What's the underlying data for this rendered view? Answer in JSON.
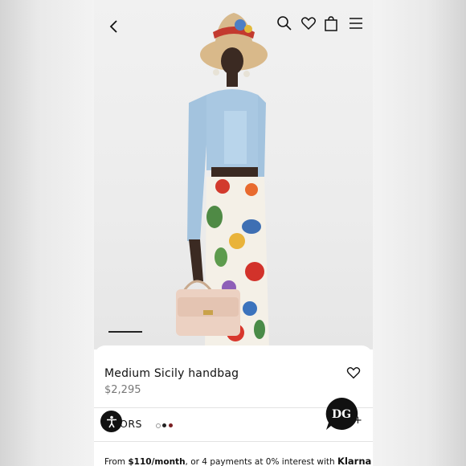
{
  "product": {
    "title": "Medium Sicily handbag",
    "price": "$2,295"
  },
  "colors": {
    "label": "LORS",
    "swatches": [
      "#ffffff",
      "#222222",
      "#7a1f22"
    ]
  },
  "chat_badge": "DG",
  "plus_label": "+",
  "klarna": {
    "prefix": "From ",
    "amount": "$110/month",
    "middle": ", or 4 payments at 0% interest with ",
    "brand": "Klarna"
  },
  "icons": {
    "back": "chevron-left-icon",
    "search": "search-icon",
    "wishlist": "heart-icon",
    "bag": "shopping-bag-icon",
    "menu": "hamburger-menu-icon",
    "accessibility": "accessibility-icon"
  }
}
